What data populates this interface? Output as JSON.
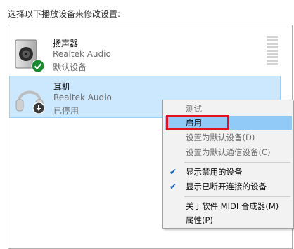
{
  "instruction": "选择以下播放设备来修改设置:",
  "devices": [
    {
      "name": "扬声器",
      "driver": "Realtek Audio",
      "status": "默认设备",
      "icon": "speaker-icon",
      "badge": "default-check-icon",
      "selected": false
    },
    {
      "name": "耳机",
      "driver": "Realtek Audio",
      "status": "已停用",
      "icon": "headphones-icon",
      "badge": "disabled-arrow-icon",
      "selected": true
    }
  ],
  "context_menu": {
    "items": [
      {
        "label": "测试",
        "enabled": false,
        "checked": false
      },
      {
        "label": "启用",
        "enabled": true,
        "checked": false,
        "highlighted": true
      },
      {
        "label": "设置为默认设备(D)",
        "enabled": false,
        "checked": false
      },
      {
        "label": "设置为默认通信设备(C)",
        "enabled": false,
        "checked": false
      },
      {
        "label": "显示禁用的设备",
        "enabled": true,
        "checked": true
      },
      {
        "label": "显示已断开连接的设备",
        "enabled": true,
        "checked": true
      },
      {
        "label": "关于软件 MIDI 合成器(M)",
        "enabled": true,
        "checked": false
      },
      {
        "label": "属性(P)",
        "enabled": true,
        "checked": false
      }
    ]
  },
  "colors": {
    "selection_bg": "#cce8ff",
    "menu_highlight": "#91c9f7",
    "check_color": "#0a64c8",
    "annotation_red": "#e0141e",
    "default_badge": "#1a8a2e"
  }
}
